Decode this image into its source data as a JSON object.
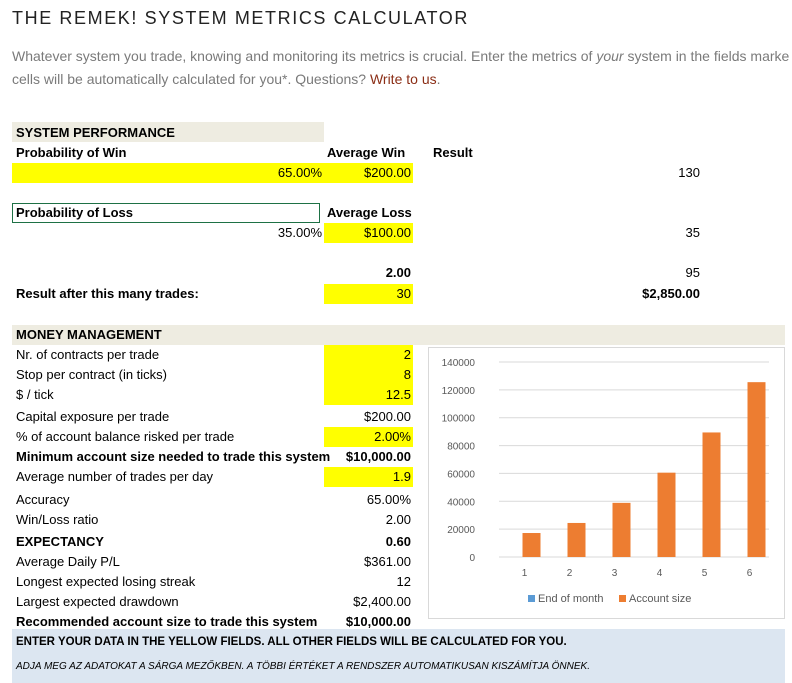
{
  "title": "THE REMEK! SYSTEM METRICS CALCULATOR",
  "intro": {
    "line1_a": "Whatever system you trade, knowing and monitoring its metrics is crucial. Enter the metrics of ",
    "line1_em": "your",
    "line1_b": " system in the fields marke",
    "line2_a": "cells will be automatically calculated for you*.  Questions? ",
    "link": "Write to us",
    "line2_b": "."
  },
  "performance": {
    "header": "SYSTEM PERFORMANCE",
    "prob_win_label": "Probability of Win",
    "avg_win_label": "Average Win",
    "result_label": "Result",
    "prob_win": "65.00%",
    "avg_win": "$200.00",
    "result_win": "130",
    "prob_loss_label": "Probability of Loss",
    "avg_loss_label": "Average Loss",
    "prob_loss": "35.00%",
    "avg_loss": "$100.00",
    "result_loss": "35",
    "ratio": "2.00",
    "net": "95",
    "trades_label": "Result after this many trades:",
    "trades": "30",
    "trades_result": "$2,850.00"
  },
  "money": {
    "header": "MONEY MANAGEMENT",
    "rows": [
      {
        "label": "Nr. of contracts per trade",
        "value": "2",
        "yellow": true,
        "bold": false
      },
      {
        "label": "Stop per contract (in ticks)",
        "value": "8",
        "yellow": true,
        "bold": false
      },
      {
        "label": "$ / tick",
        "value": "12.5",
        "yellow": true,
        "bold": false
      },
      {
        "label": "Capital exposure per trade",
        "value": "$200.00",
        "yellow": false,
        "bold": false
      },
      {
        "label": "% of account balance risked per trade",
        "value": "2.00%",
        "yellow": true,
        "bold": false
      },
      {
        "label": "Minimum account size needed to trade this system",
        "value": "$10,000.00",
        "yellow": false,
        "bold": true
      },
      {
        "label": "Average number of trades per day",
        "value": "1.9",
        "yellow": true,
        "bold": false
      },
      {
        "label": "Accuracy",
        "value": "65.00%",
        "yellow": false,
        "bold": false
      },
      {
        "label": "Win/Loss ratio",
        "value": "2.00",
        "yellow": false,
        "bold": false
      },
      {
        "label": "EXPECTANCY",
        "value": "0.60",
        "yellow": false,
        "bold": true
      },
      {
        "label": "Average Daily P/L",
        "value": "$361.00",
        "yellow": false,
        "bold": false
      },
      {
        "label": "Longest expected losing streak",
        "value": "12",
        "yellow": false,
        "bold": false
      },
      {
        "label": "Largest expected drawdown",
        "value": "$2,400.00",
        "yellow": false,
        "bold": false
      },
      {
        "label": "Recommended account size to trade this system",
        "value": "$10,000.00",
        "yellow": false,
        "bold": true
      }
    ]
  },
  "footer": {
    "line1": "ENTER YOUR DATA IN THE YELLOW FIELDS. ALL OTHER FIELDS WILL BE CALCULATED FOR YOU.",
    "line2": "ADJA MEG AZ ADATOKAT A SÁRGA MEZŐKBEN. A TÖBBI ÉRTÉKET A RENDSZER AUTOMATIKUSAN KISZÁMÍTJA ÖNNEK."
  },
  "colors": {
    "yellow": "#ffff00",
    "band": "#eeece1",
    "footer_band": "#dce6f1",
    "account_series": "#ed7d31",
    "month_series": "#5b9bd5",
    "link": "#8b2e16"
  },
  "chart_data": {
    "type": "bar",
    "categories": [
      "1",
      "2",
      "3",
      "4",
      "5",
      "6"
    ],
    "series": [
      {
        "name": "End of month",
        "values": [
          0,
          0,
          0,
          0,
          0,
          0
        ]
      },
      {
        "name": "Account size",
        "values": [
          17220,
          24440,
          38880,
          60540,
          89420,
          125520
        ]
      }
    ],
    "ylim": [
      0,
      140000
    ],
    "yticks": [
      "0",
      "20000",
      "40000",
      "60000",
      "80000",
      "100000",
      "120000",
      "140000"
    ],
    "grid": true,
    "legend": "bottom"
  }
}
